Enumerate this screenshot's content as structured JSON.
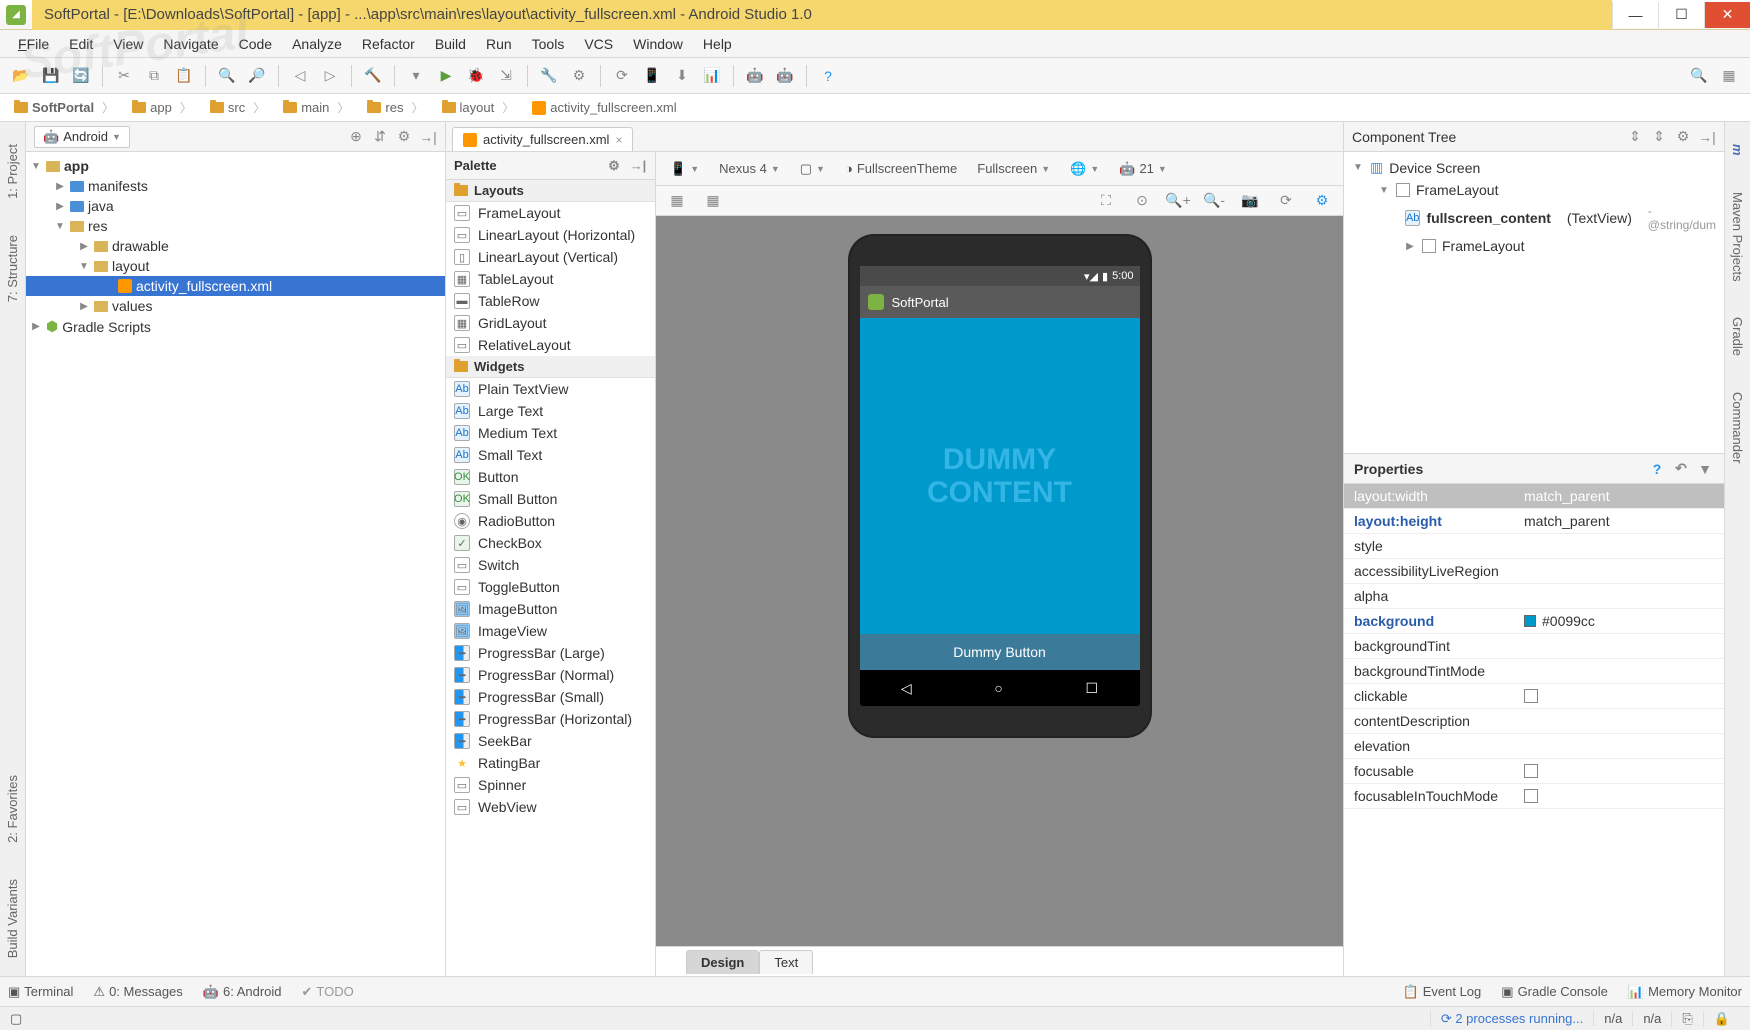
{
  "window": {
    "title": "SoftPortal - [E:\\Downloads\\SoftPortal] - [app] - ...\\app\\src\\main\\res\\layout\\activity_fullscreen.xml - Android Studio 1.0"
  },
  "menu": [
    "File",
    "Edit",
    "View",
    "Navigate",
    "Code",
    "Analyze",
    "Refactor",
    "Build",
    "Run",
    "Tools",
    "VCS",
    "Window",
    "Help"
  ],
  "breadcrumb": [
    "SoftPortal",
    "app",
    "src",
    "main",
    "res",
    "layout",
    "activity_fullscreen.xml"
  ],
  "project": {
    "mode": "Android",
    "root": "app",
    "tree": {
      "manifests": "manifests",
      "java": "java",
      "res": "res",
      "drawable": "drawable",
      "layout": "layout",
      "activity": "activity_fullscreen.xml",
      "values": "values",
      "gradle": "Gradle Scripts"
    }
  },
  "editor": {
    "tab": "activity_fullscreen.xml",
    "footer": {
      "design": "Design",
      "text": "Text"
    }
  },
  "palette": {
    "title": "Palette",
    "groups": {
      "layouts": "Layouts",
      "widgets": "Widgets"
    },
    "layouts": [
      "FrameLayout",
      "LinearLayout (Horizontal)",
      "LinearLayout (Vertical)",
      "TableLayout",
      "TableRow",
      "GridLayout",
      "RelativeLayout"
    ],
    "widgets": [
      "Plain TextView",
      "Large Text",
      "Medium Text",
      "Small Text",
      "Button",
      "Small Button",
      "RadioButton",
      "CheckBox",
      "Switch",
      "ToggleButton",
      "ImageButton",
      "ImageView",
      "ProgressBar (Large)",
      "ProgressBar (Normal)",
      "ProgressBar (Small)",
      "ProgressBar (Horizontal)",
      "SeekBar",
      "RatingBar",
      "Spinner",
      "WebView"
    ]
  },
  "preview_toolbar": {
    "device": "Nexus 4",
    "theme": "FullscreenTheme",
    "config": "Fullscreen",
    "api": "21"
  },
  "preview": {
    "status_time": "5:00",
    "app_title": "SoftPortal",
    "content_line1": "DUMMY",
    "content_line2": "CONTENT",
    "button": "Dummy Button"
  },
  "component_tree": {
    "title": "Component Tree",
    "root": "Device Screen",
    "frame": "FrameLayout",
    "fullscreen": "fullscreen_content",
    "fullscreen_type": "(TextView)",
    "fullscreen_hint": "- @string/dum",
    "frame2": "FrameLayout"
  },
  "properties": {
    "title": "Properties",
    "rows": [
      {
        "key": "layout:width",
        "val": "match_parent",
        "hdr": true
      },
      {
        "key": "layout:height",
        "val": "match_parent",
        "bold": true
      },
      {
        "key": "style",
        "val": ""
      },
      {
        "key": "accessibilityLiveRegion",
        "val": ""
      },
      {
        "key": "alpha",
        "val": ""
      },
      {
        "key": "background",
        "val": "#0099cc",
        "bold": true,
        "color": true
      },
      {
        "key": "backgroundTint",
        "val": ""
      },
      {
        "key": "backgroundTintMode",
        "val": ""
      },
      {
        "key": "clickable",
        "val": "",
        "check": true
      },
      {
        "key": "contentDescription",
        "val": ""
      },
      {
        "key": "elevation",
        "val": ""
      },
      {
        "key": "focusable",
        "val": "",
        "check": true
      },
      {
        "key": "focusableInTouchMode",
        "val": "",
        "check": true
      }
    ]
  },
  "bottom": {
    "terminal": "Terminal",
    "messages": "0: Messages",
    "android": "6: Android",
    "todo": "TODO",
    "eventlog": "Event Log",
    "gradle": "Gradle Console",
    "memory": "Memory Monitor"
  },
  "status": {
    "processes": "2 processes running...",
    "na1": "n/a",
    "na2": "n/a"
  },
  "side_tabs": {
    "project": "1: Project",
    "structure": "7: Structure",
    "favorites": "2: Favorites",
    "variants": "Build Variants",
    "maven": "Maven Projects",
    "gradle": "Gradle",
    "commander": "Commander"
  }
}
